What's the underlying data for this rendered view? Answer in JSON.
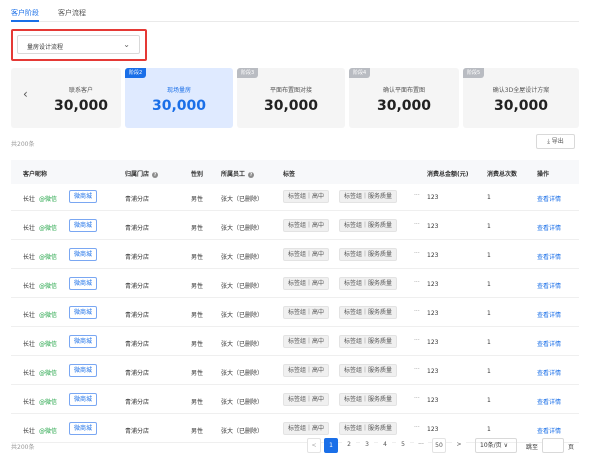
{
  "tabs": [
    {
      "label": "客户阶段",
      "active": true
    },
    {
      "label": "客户流程",
      "active": false
    }
  ],
  "dropdown": {
    "value": "量房设计流程"
  },
  "stages": {
    "prev": {
      "name": "联系客户",
      "value": "30,000"
    },
    "items": [
      {
        "badge": "阶段2",
        "name": "现场量房",
        "value": "30,000",
        "active": true
      },
      {
        "badge": "阶段3",
        "name": "平面布置图对接",
        "value": "30,000",
        "active": false
      },
      {
        "badge": "阶段4",
        "name": "确认平面布置图",
        "value": "30,000",
        "active": false
      },
      {
        "badge": "阶段5",
        "name": "确认3D全屋设计方案",
        "value": "30,000",
        "active": false
      }
    ]
  },
  "total_top": "共200条",
  "export_label": "⤓ 导出",
  "table": {
    "headers": {
      "nickname": "客户昵称",
      "store": "归属门店",
      "gender": "性别",
      "staff": "所属员工",
      "tags": "标签",
      "amount": "消费总金额(元)",
      "count": "消费总次数",
      "action": "操作"
    },
    "rows": [
      {
        "name": "长壮",
        "wechat": "@微信",
        "shop": "微商城",
        "store": "青浦分店",
        "gender": "男性",
        "staff": "张大（已删除）",
        "tag1": "标签组｜高中",
        "tag2": "标签组｜服务质量",
        "more": "···",
        "amount": "123",
        "count": "1",
        "action": "查看详情"
      },
      {
        "name": "长壮",
        "wechat": "@微信",
        "shop": "微商城",
        "store": "青浦分店",
        "gender": "男性",
        "staff": "张大（已删除）",
        "tag1": "标签组｜高中",
        "tag2": "标签组｜服务质量",
        "more": "···",
        "amount": "123",
        "count": "1",
        "action": "查看详情"
      },
      {
        "name": "长壮",
        "wechat": "@微信",
        "shop": "微商城",
        "store": "青浦分店",
        "gender": "男性",
        "staff": "张大（已删除）",
        "tag1": "标签组｜高中",
        "tag2": "标签组｜服务质量",
        "more": "···",
        "amount": "123",
        "count": "1",
        "action": "查看详情"
      },
      {
        "name": "长壮",
        "wechat": "@微信",
        "shop": "微商城",
        "store": "青浦分店",
        "gender": "男性",
        "staff": "张大（已删除）",
        "tag1": "标签组｜高中",
        "tag2": "标签组｜服务质量",
        "more": "···",
        "amount": "123",
        "count": "1",
        "action": "查看详情"
      },
      {
        "name": "长壮",
        "wechat": "@微信",
        "shop": "微商城",
        "store": "青浦分店",
        "gender": "男性",
        "staff": "张大（已删除）",
        "tag1": "标签组｜高中",
        "tag2": "标签组｜服务质量",
        "more": "···",
        "amount": "123",
        "count": "1",
        "action": "查看详情"
      },
      {
        "name": "长壮",
        "wechat": "@微信",
        "shop": "微商城",
        "store": "青浦分店",
        "gender": "男性",
        "staff": "张大（已删除）",
        "tag1": "标签组｜高中",
        "tag2": "标签组｜服务质量",
        "more": "···",
        "amount": "123",
        "count": "1",
        "action": "查看详情"
      },
      {
        "name": "长壮",
        "wechat": "@微信",
        "shop": "微商城",
        "store": "青浦分店",
        "gender": "男性",
        "staff": "张大（已删除）",
        "tag1": "标签组｜高中",
        "tag2": "标签组｜服务质量",
        "more": "···",
        "amount": "123",
        "count": "1",
        "action": "查看详情"
      },
      {
        "name": "长壮",
        "wechat": "@微信",
        "shop": "微商城",
        "store": "青浦分店",
        "gender": "男性",
        "staff": "张大（已删除）",
        "tag1": "标签组｜高中",
        "tag2": "标签组｜服务质量",
        "more": "···",
        "amount": "123",
        "count": "1",
        "action": "查看详情"
      },
      {
        "name": "长壮",
        "wechat": "@微信",
        "shop": "微商城",
        "store": "青浦分店",
        "gender": "男性",
        "staff": "张大（已删除）",
        "tag1": "标签组｜高中",
        "tag2": "标签组｜服务质量",
        "more": "···",
        "amount": "123",
        "count": "1",
        "action": "查看详情"
      }
    ]
  },
  "pagination": {
    "total": "共200条",
    "prev": "<",
    "pages": [
      "1",
      "2",
      "3",
      "4",
      "5"
    ],
    "ellipsis": "···",
    "last": "50",
    "next": ">",
    "page_size": "10条/页 ∨",
    "goto_label": "跳至",
    "goto_suffix": "页"
  },
  "colors": {
    "accent": "#1a6fe8",
    "highlight": "#e53935",
    "wechat": "#22a447"
  }
}
